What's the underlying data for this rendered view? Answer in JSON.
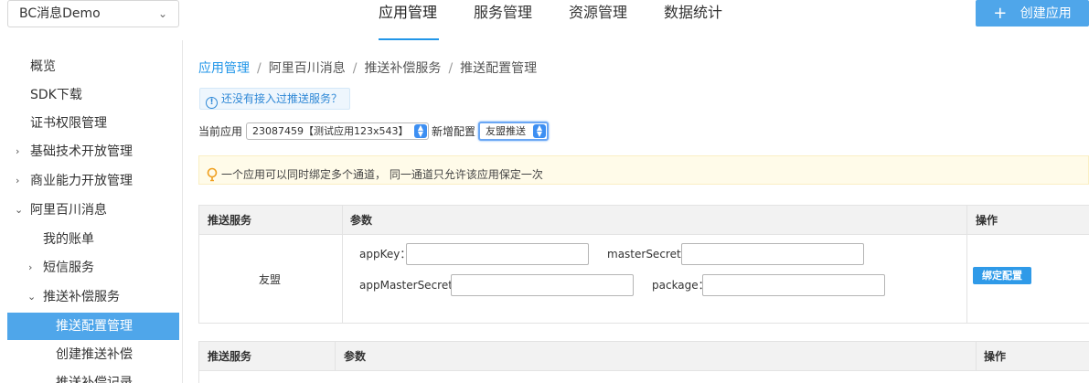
{
  "header": {
    "app_selector": {
      "value": "BC消息Demo",
      "icon": "chevron-down-icon"
    },
    "tabs": [
      {
        "label": "应用管理",
        "active": true
      },
      {
        "label": "服务管理",
        "active": false
      },
      {
        "label": "资源管理",
        "active": false
      },
      {
        "label": "数据统计",
        "active": false
      }
    ],
    "create_button": {
      "label": "创建应用",
      "icon": "plus-icon"
    }
  },
  "sidebar": {
    "items": [
      {
        "label": "概览",
        "expandable": false
      },
      {
        "label": "SDK下载",
        "expandable": false
      },
      {
        "label": "证书权限管理",
        "expandable": false
      },
      {
        "label": "基础技术开放管理",
        "expandable": true,
        "expanded": false
      },
      {
        "label": "商业能力开放管理",
        "expandable": true,
        "expanded": false
      },
      {
        "label": "阿里百川消息",
        "expandable": true,
        "expanded": true
      },
      {
        "label": "我的账单",
        "expandable": false
      },
      {
        "label": "短信服务",
        "expandable": true,
        "expanded": false
      },
      {
        "label": "推送补偿服务",
        "expandable": true,
        "expanded": true
      },
      {
        "label": "推送配置管理",
        "active": true
      },
      {
        "label": "创建推送补偿",
        "active": false
      },
      {
        "label": "推送补偿记录",
        "active": false
      }
    ]
  },
  "breadcrumb": [
    "应用管理",
    "阿里百川消息",
    "推送补偿服务",
    "推送配置管理"
  ],
  "info_tip": "还没有接入过推送服务？",
  "form": {
    "current_app_label": "当前应用",
    "current_app_value": "23087459【测试应用123x543】",
    "new_config_label": "新增配置",
    "new_config_value": "友盟推送"
  },
  "warning_tip": "一个应用可以同时绑定多个通道， 同一通道只允许该应用保定一次",
  "table1": {
    "headers": [
      "推送服务",
      "参数",
      "操作"
    ],
    "row": {
      "service": "友盟",
      "fields": [
        {
          "label": "appKey：",
          "value": ""
        },
        {
          "label": "masterSecret：",
          "value": ""
        },
        {
          "label": "appMasterSecret：",
          "value": ""
        },
        {
          "label": "package：",
          "value": ""
        }
      ],
      "action": "绑定配置"
    }
  },
  "table2": {
    "headers": [
      "推送服务",
      "参数",
      "操作"
    ]
  },
  "colors": {
    "accent": "#2196e8",
    "button": "#4fa6ea",
    "warning_bg": "#fffbe9",
    "info_bg": "#eef6fd"
  }
}
